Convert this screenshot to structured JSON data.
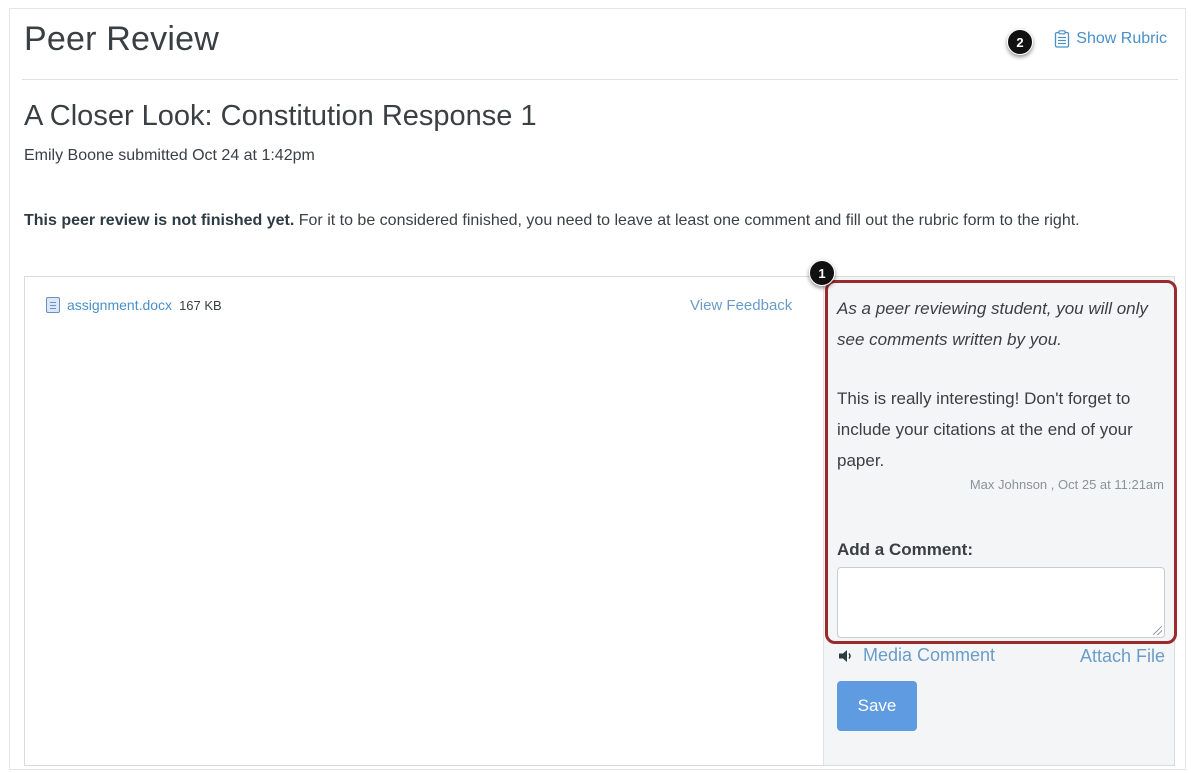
{
  "header": {
    "title": "Peer Review",
    "show_rubric_label": "Show Rubric",
    "rubric_icon": "rubric-clipboard-icon"
  },
  "callouts": {
    "one": "1",
    "two": "2"
  },
  "assignment": {
    "title": "A Closer Look: Constitution Response 1",
    "submitted": "Emily Boone submitted Oct 24 at 1:42pm"
  },
  "notice": {
    "bold": "This peer review is not finished yet.",
    "rest": " For it to be considered finished, you need to leave at least one comment and fill out the rubric form to the right."
  },
  "file": {
    "name": "assignment.docx",
    "size": "167 KB",
    "icon": "document-icon"
  },
  "view_feedback_label": "View Feedback",
  "sidebar": {
    "note": "As a peer reviewing student, you will only see comments written by you.",
    "comment_text": "This is really interesting! Don't forget to include your citations at the end of your paper.",
    "comment_meta": "Max Johnson , Oct 25 at 11:21am",
    "add_comment_label": "Add a Comment:",
    "comment_value": "",
    "media_comment_label": "Media Comment",
    "attach_file_label": "Attach File",
    "save_label": "Save"
  },
  "colors": {
    "link": "#4a90c8",
    "highlight_border": "#9b2a2e",
    "save_button": "#5f9be0"
  }
}
